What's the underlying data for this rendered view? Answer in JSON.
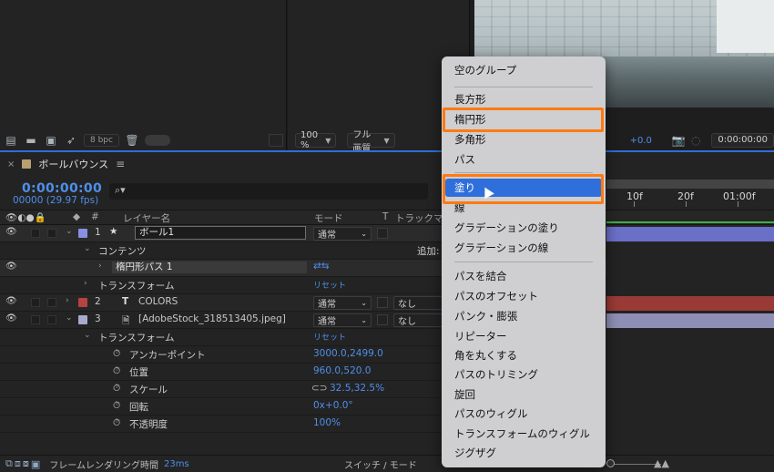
{
  "project": {
    "bpc_label": "8 bpc"
  },
  "comp_viewer": {
    "zoom": "100 %",
    "resolution": "フル画質",
    "exposure": "+0.0",
    "time": "0:00:00:00"
  },
  "timeline": {
    "close": "×",
    "comp_name": "ボールバウンス",
    "menu_icon": "≡",
    "timecode": "0:00:00:00",
    "fps": "00000 (29.97 fps)",
    "ruler_ticks": [
      "10f",
      "20f",
      "01:00f"
    ],
    "columns": {
      "hash": "#",
      "layer_name": "レイヤー名",
      "mode": "モード",
      "t": "T",
      "trkmat": "トラックマット"
    },
    "add_label": "追加:",
    "reset_label": "リセット",
    "layers": [
      {
        "num": "1",
        "name": "ボール1",
        "mode": "通常",
        "color": "#8a8fe6"
      },
      {
        "num": "2",
        "name": "COLORS",
        "mode": "通常",
        "trkmat": "なし",
        "color": "#b5433f"
      },
      {
        "num": "3",
        "name": "[AdobeStock_318513405.jpeg]",
        "mode": "通常",
        "trkmat": "なし",
        "color": "#a9a9cc"
      }
    ],
    "contents_label": "コンテンツ",
    "ellipse_path": "楕円形パス 1",
    "transform_label": "トランスフォーム",
    "properties": [
      {
        "name": "アンカーポイント",
        "value": "3000.0,2499.0"
      },
      {
        "name": "位置",
        "value": "960.0,520.0"
      },
      {
        "name": "スケール",
        "value": "32.5,32.5%"
      },
      {
        "name": "回転",
        "value": "0x+0.0°"
      },
      {
        "name": "不透明度",
        "value": "100%"
      }
    ],
    "bar_colors": {
      "layer1": "#6a6fc8",
      "layer2": "#9a3a36",
      "layer3": "#8f8fb6"
    },
    "footer": {
      "render_label": "フレームレンダリング時間",
      "render_time": "23ms",
      "switch_mode": "スイッチ / モード"
    }
  },
  "context_menu": {
    "items": [
      "空のグループ",
      "長方形",
      "楕円形",
      "多角形",
      "パス",
      "塗り",
      "線",
      "グラデーションの塗り",
      "グラデーションの線",
      "パスを結合",
      "パスのオフセット",
      "パンク・膨張",
      "リピーター",
      "角を丸くする",
      "パスのトリミング",
      "旋回",
      "パスのウィグル",
      "トランスフォームのウィグル",
      "ジグザグ"
    ],
    "highlight_color": "#2f6fdb",
    "annotation_color": "#ff7a12"
  }
}
